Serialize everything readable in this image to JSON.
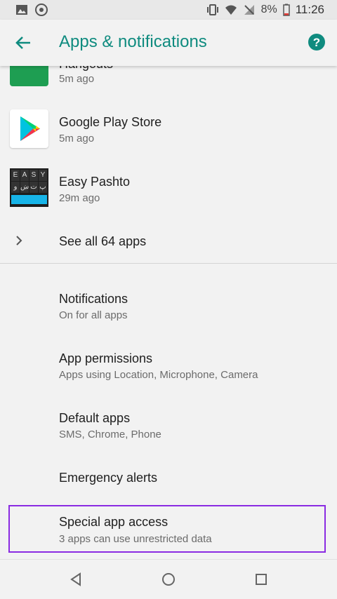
{
  "status_bar": {
    "battery": "8%",
    "time": "11:26"
  },
  "app_bar": {
    "title": "Apps & notifications"
  },
  "recent_apps": [
    {
      "name": "Hangouts",
      "time": "5m ago"
    },
    {
      "name": "Google Play Store",
      "time": "5m ago"
    },
    {
      "name": "Easy Pashto",
      "time": "29m ago"
    }
  ],
  "see_all": {
    "label": "See all 64 apps"
  },
  "settings": [
    {
      "title": "Notifications",
      "subtitle": "On for all apps"
    },
    {
      "title": "App permissions",
      "subtitle": "Apps using Location, Microphone, Camera"
    },
    {
      "title": "Default apps",
      "subtitle": "SMS, Chrome, Phone"
    },
    {
      "title": "Emergency alerts",
      "subtitle": ""
    },
    {
      "title": "Special app access",
      "subtitle": "3 apps can use unrestricted data"
    }
  ],
  "keyboard_icon_keys": [
    "E",
    "A",
    "S",
    "Y",
    "و",
    "ښ",
    "ت",
    "پ"
  ],
  "colors": {
    "accent": "#0f8b7f",
    "highlight": "#8a2be2"
  }
}
